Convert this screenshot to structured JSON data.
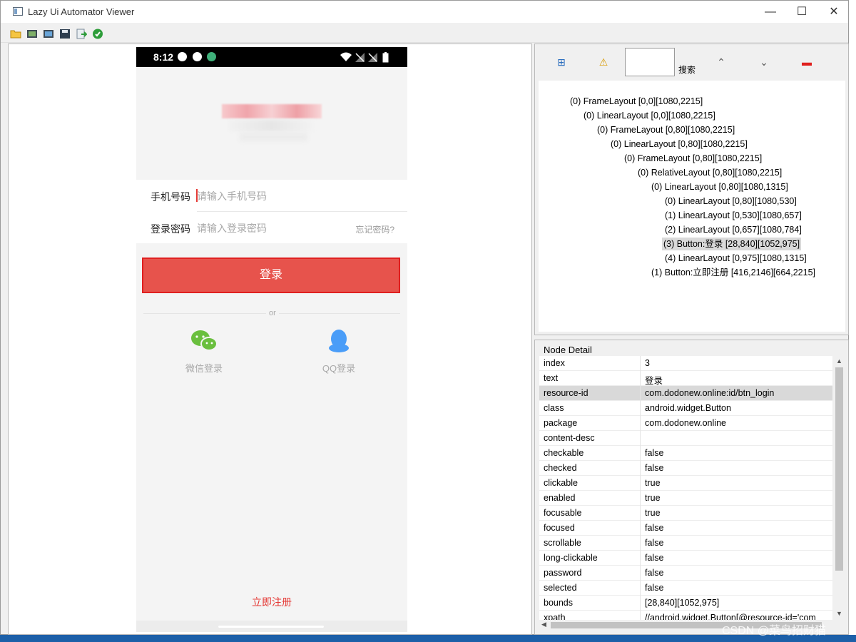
{
  "window": {
    "title": "Lazy Ui Automator Viewer",
    "minimize": "—",
    "maximize": "☐",
    "close": "✕"
  },
  "toolbar": {
    "icons": [
      "open-folder-icon",
      "screenshot-icon",
      "screenshot-compressed-icon",
      "save-icon",
      "export-icon",
      "refresh-icon"
    ]
  },
  "phone": {
    "status": {
      "time": "8:12"
    },
    "form": {
      "phone_label": "手机号码",
      "phone_placeholder": "请输入手机号码",
      "password_label": "登录密码",
      "password_placeholder": "请输入登录密码",
      "forgot": "忘记密码?"
    },
    "login_button": "登录",
    "or": "or",
    "social": {
      "wechat": "微信登录",
      "qq": "QQ登录"
    },
    "register": "立即注册",
    "colors": {
      "accent": "#e7534c",
      "wechat": "#6abf3e",
      "qq": "#4a9df8"
    }
  },
  "tree_toolbar": {
    "search_label": "搜索",
    "search_value": ""
  },
  "tree": [
    "(0) FrameLayout [0,0][1080,2215]",
    "(0) LinearLayout [0,0][1080,2215]",
    "(0) FrameLayout [0,80][1080,2215]",
    "(0) LinearLayout [0,80][1080,2215]",
    "(0) FrameLayout [0,80][1080,2215]",
    "(0) RelativeLayout [0,80][1080,2215]",
    "(0) LinearLayout [0,80][1080,1315]",
    "(0) LinearLayout [0,80][1080,530]",
    "(1) LinearLayout [0,530][1080,657]",
    "(2) LinearLayout [0,657][1080,784]",
    "(3) Button:登录 [28,840][1052,975]",
    "(4) LinearLayout [0,975][1080,1315]",
    "(1) Button:立即注册 [416,2146][664,2215]"
  ],
  "detail": {
    "title": "Node Detail",
    "rows": [
      [
        "index",
        "3"
      ],
      [
        "text",
        "登录"
      ],
      [
        "resource-id",
        "com.dodonew.online:id/btn_login"
      ],
      [
        "class",
        "android.widget.Button"
      ],
      [
        "package",
        "com.dodonew.online"
      ],
      [
        "content-desc",
        ""
      ],
      [
        "checkable",
        "false"
      ],
      [
        "checked",
        "false"
      ],
      [
        "clickable",
        "true"
      ],
      [
        "enabled",
        "true"
      ],
      [
        "focusable",
        "true"
      ],
      [
        "focused",
        "false"
      ],
      [
        "scrollable",
        "false"
      ],
      [
        "long-clickable",
        "false"
      ],
      [
        "password",
        "false"
      ],
      [
        "selected",
        "false"
      ],
      [
        "bounds",
        "[28,840][1052,975]"
      ],
      [
        "xpath",
        "//android.widget.Button[@resource-id='com"
      ]
    ]
  },
  "watermark": "CSDN @菜鸟招财猫"
}
